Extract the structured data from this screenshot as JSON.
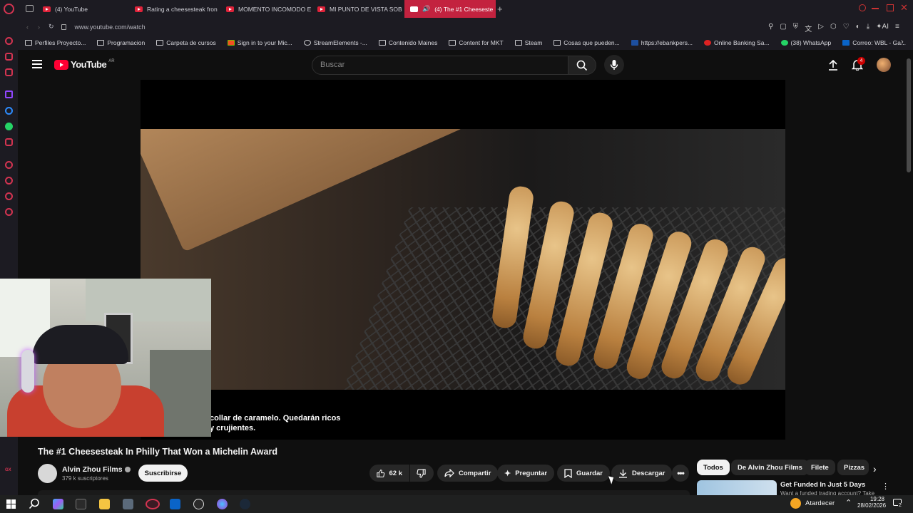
{
  "browser": {
    "tabs": [
      {
        "label": "(4) YouTube",
        "active": false
      },
      {
        "label": "Rating a cheesesteak fron",
        "active": false
      },
      {
        "label": "MOMENTO INCOMODO E",
        "active": false
      },
      {
        "label": "MI PUNTO DE VISTA SOB",
        "active": false
      },
      {
        "label": "(4) The #1 Cheeseste",
        "active": true
      }
    ],
    "url": "www.youtube.com/watch",
    "bookmarks": [
      "Perfiles Proyecto...",
      "Programacion",
      "Carpeta de cursos",
      "Sign in to your Mic...",
      "StreamElements -...",
      "Contenido Maines",
      "Content for MKT",
      "Steam",
      "Cosas que pueden...",
      "https://ebankpers...",
      "Online Banking Sa...",
      "(38) WhatsApp",
      "Correo: WBL - Ga..."
    ]
  },
  "youtube": {
    "logo_text": "YouTube",
    "region": "AR",
    "search_placeholder": "Buscar",
    "notifications_count": "4"
  },
  "video": {
    "subtitle_line1": "collar de caramelo.  Quedarán ricos",
    "subtitle_line2": "y crujientes.",
    "title": "The #1 Cheesesteak In Philly That Won a Michelin Award",
    "channel": "Alvin Zhou Films",
    "subscribers": "379 k suscriptores",
    "subscribe_label": "Suscribirse",
    "likes": "62 k",
    "share_label": "Compartir",
    "ask_label": "Preguntar",
    "save_label": "Guardar",
    "download_label": "Descargar"
  },
  "chips": [
    "Todos",
    "De Alvin Zhou Films",
    "Filete",
    "Pizzas"
  ],
  "recommendation": {
    "title": "Get Funded In Just 5 Days",
    "snippet": "Want a funded trading account? Take"
  },
  "taskbar": {
    "weather": "Atardecer",
    "time": "19:28",
    "date": "28/02/2026",
    "notifications": "2"
  },
  "colors": {
    "accent_red": "#c3223f",
    "yt_red": "#ff0033",
    "background": "#0f0f0f"
  }
}
